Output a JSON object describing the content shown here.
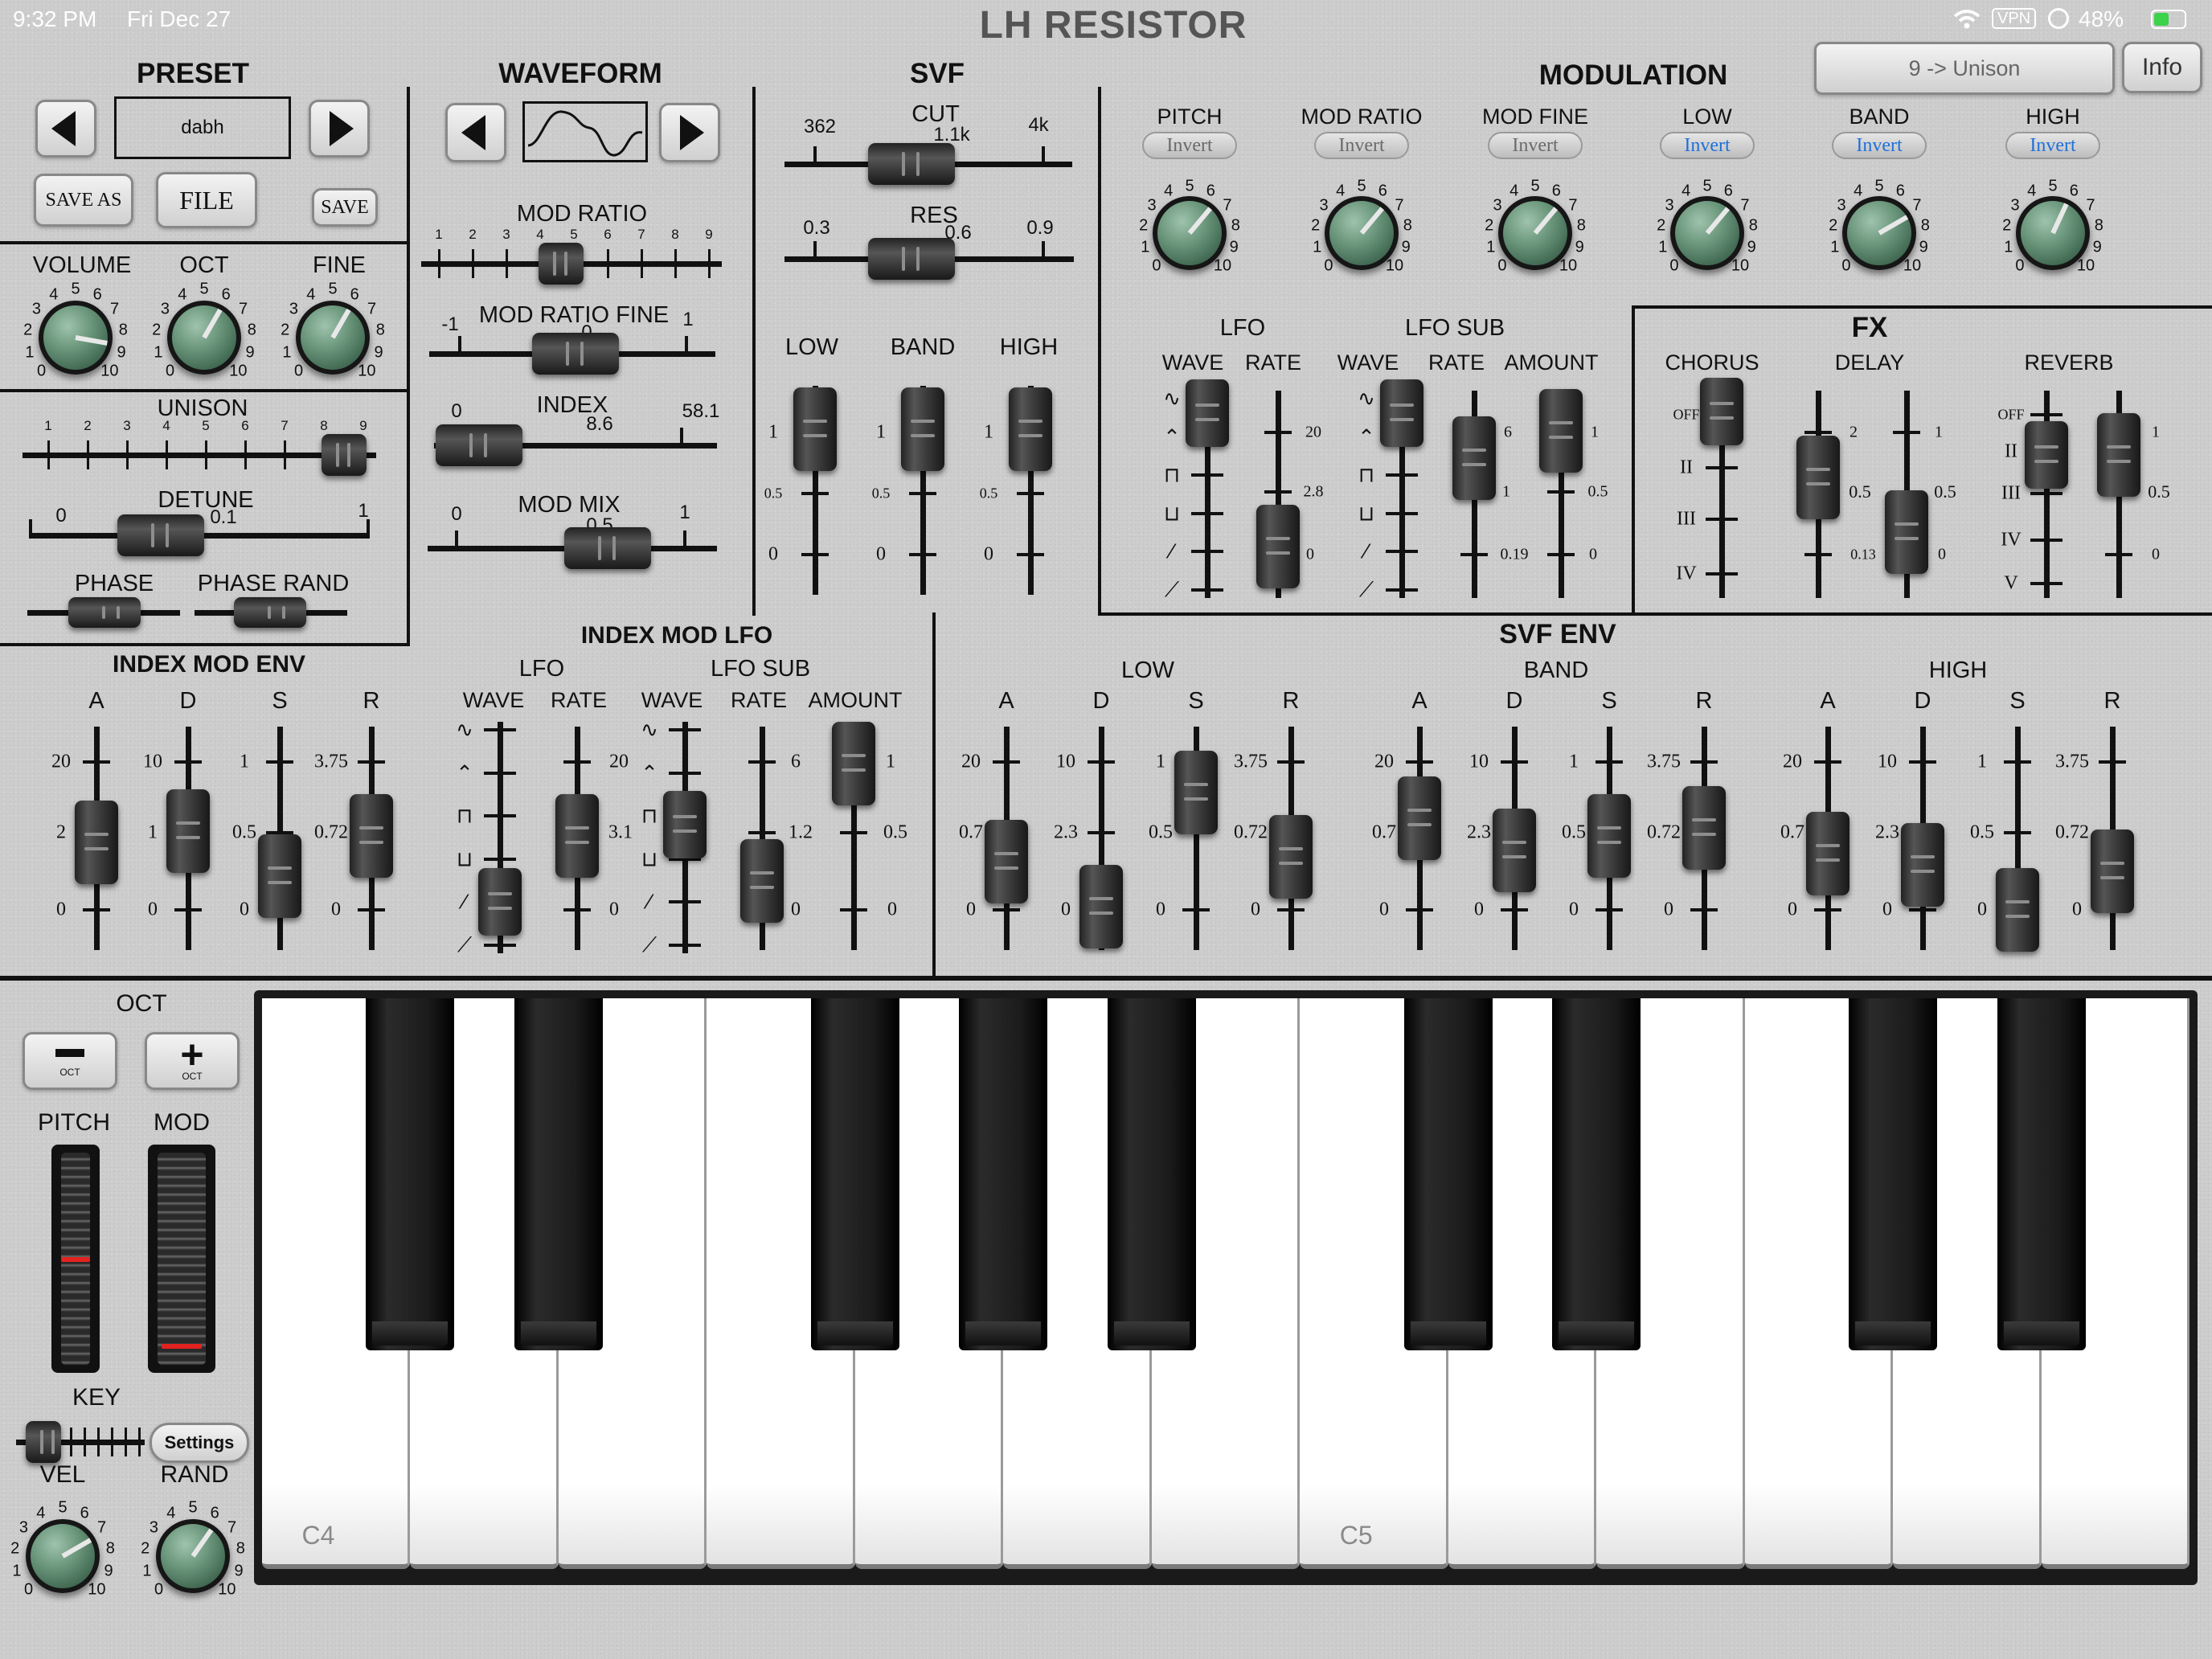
{
  "status": {
    "time": "9:32 PM",
    "date": "Fri Dec 27",
    "vpn": "VPN",
    "battery": "48%"
  },
  "app": {
    "title": "LH RESISTOR",
    "preset_display": "9 -> Unison",
    "info_label": "Info"
  },
  "preset": {
    "title": "PRESET",
    "name": "dabh",
    "save_as": "SAVE AS",
    "file": "FILE",
    "save": "SAVE"
  },
  "waveform": {
    "title": "WAVEFORM",
    "mod_ratio": "MOD RATIO",
    "mod_ratio_fine": "MOD RATIO FINE",
    "mrf_min": "-1",
    "mrf_val": "0",
    "mrf_max": "1",
    "index": "INDEX",
    "idx_min": "0",
    "idx_val": "8.6",
    "idx_max": "58.1",
    "mod_mix": "MOD MIX",
    "mm_min": "0",
    "mm_val": "0.5",
    "mm_max": "1",
    "mr_ticks": [
      "1",
      "2",
      "3",
      "4",
      "5",
      "6",
      "7",
      "8",
      "9"
    ]
  },
  "master": {
    "volume": "VOLUME",
    "oct": "OCT",
    "fine": "FINE",
    "unison": "UNISON",
    "unison_ticks": [
      "1",
      "2",
      "3",
      "4",
      "5",
      "6",
      "7",
      "8",
      "9"
    ],
    "detune": "DETUNE",
    "det_min": "0",
    "det_val": "0.1",
    "det_max": "1",
    "phase": "PHASE",
    "phase_rand": "PHASE RAND"
  },
  "svf": {
    "title": "SVF",
    "cut": "CUT",
    "cut_min": "362",
    "cut_val": "1.1k",
    "cut_max": "4k",
    "res": "RES",
    "res_min": "0.3",
    "res_val": "0.6",
    "res_max": "0.9",
    "low": "LOW",
    "band": "BAND",
    "high": "HIGH",
    "t1": "1",
    "t05": "0.5",
    "t0": "0"
  },
  "modulation": {
    "title": "MODULATION",
    "cols": [
      "PITCH",
      "MOD RATIO",
      "MOD FINE",
      "LOW",
      "BAND",
      "HIGH"
    ],
    "invert": "Invert",
    "lfo": "LFO",
    "lfo_sub": "LFO SUB",
    "wave": "WAVE",
    "rate": "RATE",
    "amount": "AMOUNT",
    "rate_max": "20",
    "rate_mid": "2.8",
    "rate_min": "0",
    "sub_max": "6",
    "sub_mid": "1",
    "sub_min": "0.19",
    "amt_max": "1",
    "amt_mid": "0.5",
    "amt_min": "0"
  },
  "fx": {
    "title": "FX",
    "chorus": "CHORUS",
    "delay": "DELAY",
    "reverb": "REVERB",
    "ch_opts": [
      "OFF",
      "II",
      "III",
      "IV"
    ],
    "rv_opts": [
      "OFF",
      "II",
      "III",
      "IV",
      "V"
    ],
    "d1_max": "2",
    "d1_mid": "0.5",
    "d1_min": "0.13",
    "d2_max": "1",
    "d2_mid": "0.5",
    "d2_min": "0",
    "rv_max": "1",
    "rv_mid": "0.5",
    "rv_min": "0"
  },
  "index_mod_env": {
    "title": "INDEX MOD ENV",
    "a": "A",
    "d": "D",
    "s": "S",
    "r": "R",
    "a_max": "20",
    "a_mid": "2",
    "d_max": "10",
    "d_mid": "1",
    "s_max": "1",
    "s_mid": "0.5",
    "r_max": "3.75",
    "r_mid": "0.72",
    "zero": "0"
  },
  "index_mod_lfo": {
    "title": "INDEX MOD LFO",
    "lfo": "LFO",
    "lfo_sub": "LFO SUB",
    "wave": "WAVE",
    "rate": "RATE",
    "amount": "AMOUNT",
    "rate_max": "20",
    "rate_mid": "3.1",
    "sub_max": "6",
    "sub_mid": "1.2",
    "amt_max": "1",
    "amt_mid": "0.5",
    "zero": "0"
  },
  "svf_env": {
    "title": "SVF ENV",
    "low": "LOW",
    "band": "BAND",
    "high": "HIGH",
    "a": "A",
    "d": "D",
    "s": "S",
    "r": "R",
    "a_max": "20",
    "a_mid": "0.7",
    "d_max": "10",
    "d_mid": "2.3",
    "s_max": "1",
    "s_mid": "0.5",
    "r_max": "3.75",
    "r_mid": "0.72",
    "zero": "0"
  },
  "perf": {
    "oct": "OCT",
    "oct_small": "OCT",
    "pitch": "PITCH",
    "mod": "MOD",
    "key": "KEY",
    "settings": "Settings",
    "vel": "VEL",
    "rand": "RAND"
  },
  "keyboard": {
    "c4": "C4",
    "c5": "C5"
  },
  "knob_nums": [
    "0",
    "1",
    "2",
    "3",
    "4",
    "5",
    "6",
    "7",
    "8",
    "9",
    "10"
  ]
}
